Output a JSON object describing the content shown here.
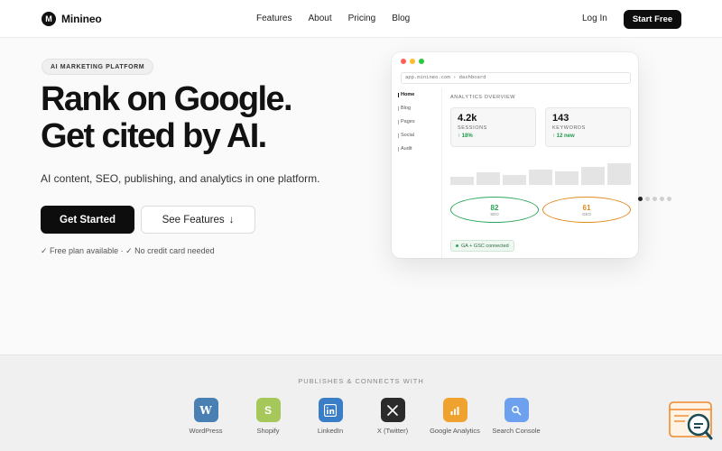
{
  "brand": {
    "name": "Minineo",
    "mark": "M"
  },
  "nav": {
    "links": [
      "Features",
      "About",
      "Pricing",
      "Blog"
    ],
    "login": "Log In",
    "cta": "Start Free"
  },
  "hero": {
    "eyebrow": "AI MARKETING PLATFORM",
    "title_line1": "Rank on Google.",
    "title_line2": "Get cited by AI.",
    "subtitle": "AI content, SEO, publishing, and analytics in one platform.",
    "primary_cta": "Get Started",
    "secondary_cta": "See Features",
    "secondary_cta_icon": "↓",
    "note": "✓ Free plan available · ✓ No credit card needed"
  },
  "dashboard": {
    "url": "app.minineo.com › dashboard",
    "sidebar": [
      "Home",
      "Blog",
      "Pages",
      "Social",
      "Audit"
    ],
    "overview_title": "ANALYTICS OVERVIEW",
    "stats": [
      {
        "value": "4.2k",
        "label": "SESSIONS",
        "change": "↑ 18%"
      },
      {
        "value": "143",
        "label": "KEYWORDS",
        "change": "↑ 12 new"
      }
    ],
    "bar_levels": [
      0.35,
      0.5,
      0.42,
      0.62,
      0.55,
      0.75,
      0.9
    ],
    "scores": [
      {
        "value": "82",
        "label": "SEO",
        "color": "#2aa65a"
      },
      {
        "value": "61",
        "label": "GEO",
        "color": "#e08a1e"
      }
    ],
    "connection": "GA + GSC connected"
  },
  "integrations": {
    "title": "PUBLISHES & CONNECTS WITH",
    "items": [
      {
        "name": "WordPress",
        "glyph": "W",
        "color": "#4a7fb4"
      },
      {
        "name": "Shopify",
        "glyph": "S",
        "color": "#a6c85a"
      },
      {
        "name": "LinkedIn",
        "glyph": "in",
        "color": "#3a7ec8"
      },
      {
        "name": "X (Twitter)",
        "glyph": "X",
        "color": "#2b2b2b"
      },
      {
        "name": "Google Analytics",
        "glyph": "ga",
        "color": "#f0a22e"
      },
      {
        "name": "Search Console",
        "glyph": "sc",
        "color": "#6ea0f0"
      }
    ]
  }
}
